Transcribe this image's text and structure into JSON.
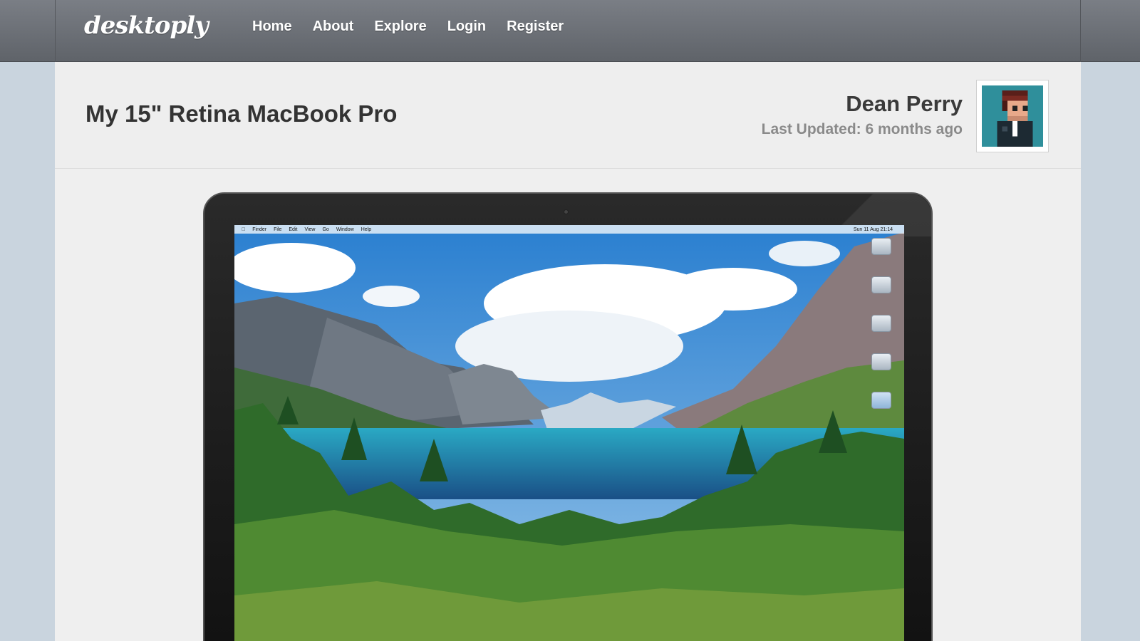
{
  "brand": {
    "logo": "desktoply"
  },
  "nav": {
    "items": [
      {
        "label": "Home"
      },
      {
        "label": "About"
      },
      {
        "label": "Explore"
      },
      {
        "label": "Login"
      },
      {
        "label": "Register"
      }
    ]
  },
  "header": {
    "title": "My 15\" Retina MacBook Pro",
    "author_name": "Dean Perry",
    "last_updated": "Last Updated: 6 months ago"
  },
  "screenshot": {
    "menubar": {
      "items": [
        "Finder",
        "File",
        "Edit",
        "View",
        "Go",
        "Window",
        "Help"
      ],
      "clock": "Sun 11 Aug  21:14"
    }
  },
  "colors": {
    "topbar": "#6b6f75",
    "page_bg": "#efefef",
    "outer_bg": "#c9d4de",
    "title": "#333333"
  }
}
